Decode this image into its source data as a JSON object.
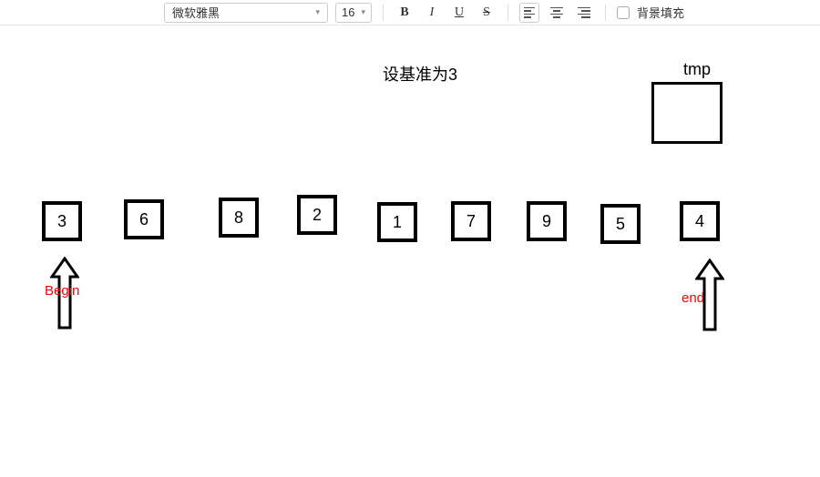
{
  "toolbar": {
    "font_name": "微软雅黑",
    "font_size": "16",
    "bold": "B",
    "italic": "I",
    "underline": "U",
    "strike": "S",
    "bgfill_label": "背景填充"
  },
  "canvas": {
    "title": "设基准为3",
    "tmp_label": "tmp",
    "array": [
      "3",
      "6",
      "8",
      "2",
      "1",
      "7",
      "9",
      "5",
      "4"
    ],
    "begin_label": "Begin",
    "end_label": "end"
  }
}
